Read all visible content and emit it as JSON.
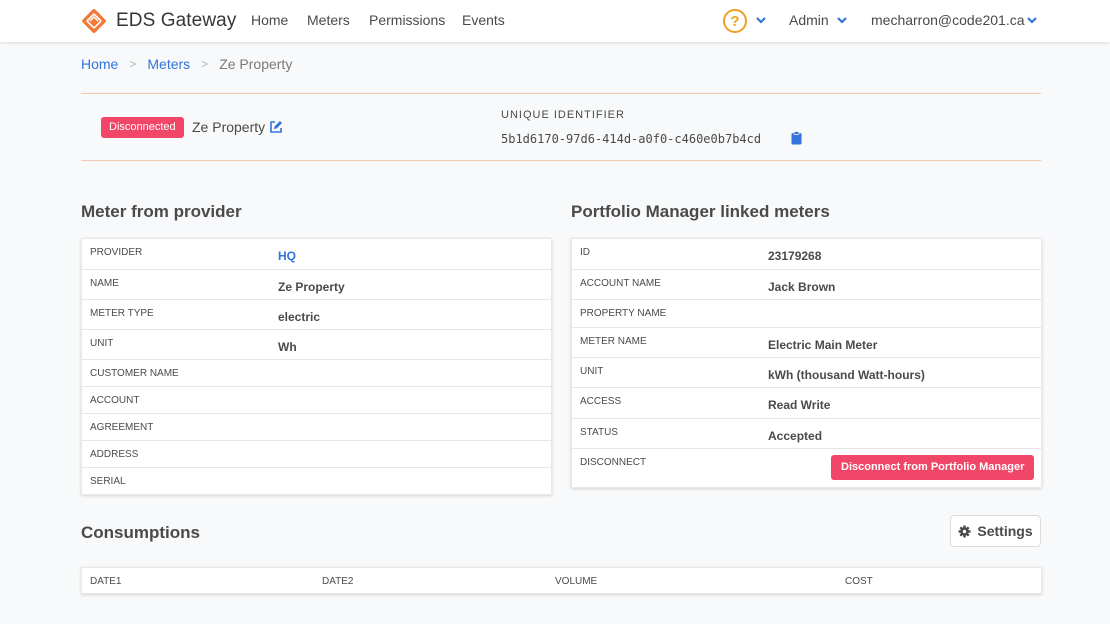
{
  "brand": {
    "name": "EDS Gateway"
  },
  "nav": {
    "links": [
      "Home",
      "Meters",
      "Permissions",
      "Events"
    ],
    "help_glyph": "?",
    "admin_label": "Admin",
    "user_email": "mecharron@code201.ca"
  },
  "breadcrumb": {
    "home": "Home",
    "meters": "Meters",
    "current": "Ze Property",
    "separator": ">"
  },
  "meter_header": {
    "status_badge": "Disconnected",
    "name": "Ze Property",
    "uid_label": "UNIQUE IDENTIFIER",
    "uid_value": "5b1d6170-97d6-414d-a0f0-c460e0b7b4cd"
  },
  "provider_section": {
    "title": "Meter from provider",
    "rows": [
      {
        "key": "PROVIDER",
        "value": "HQ"
      },
      {
        "key": "NAME",
        "value": "Ze Property"
      },
      {
        "key": "METER TYPE",
        "value": "electric"
      },
      {
        "key": "UNIT",
        "value": "Wh"
      },
      {
        "key": "CUSTOMER NAME",
        "value": ""
      },
      {
        "key": "ACCOUNT",
        "value": ""
      },
      {
        "key": "AGREEMENT",
        "value": ""
      },
      {
        "key": "ADDRESS",
        "value": ""
      },
      {
        "key": "SERIAL",
        "value": ""
      }
    ]
  },
  "portfolio_section": {
    "title": "Portfolio Manager linked meters",
    "rows": [
      {
        "key": "ID",
        "value": "23179268"
      },
      {
        "key": "ACCOUNT NAME",
        "value": "Jack Brown"
      },
      {
        "key": "PROPERTY NAME",
        "value": ""
      },
      {
        "key": "METER NAME",
        "value": "Electric Main Meter"
      },
      {
        "key": "UNIT",
        "value": "kWh (thousand Watt-hours)"
      },
      {
        "key": "ACCESS",
        "value": "Read Write"
      },
      {
        "key": "STATUS",
        "value": "Accepted"
      },
      {
        "key": "DISCONNECT",
        "value": ""
      }
    ],
    "disconnect_button": "Disconnect from Portfolio Manager"
  },
  "consumptions": {
    "title": "Consumptions",
    "settings_label": "Settings",
    "columns": [
      "DATE1",
      "DATE2",
      "VOLUME",
      "COST"
    ]
  },
  "colors": {
    "accent": "#3273dc",
    "danger": "#f14668",
    "warning": "#f0a020",
    "logo": "#f07a3a"
  }
}
